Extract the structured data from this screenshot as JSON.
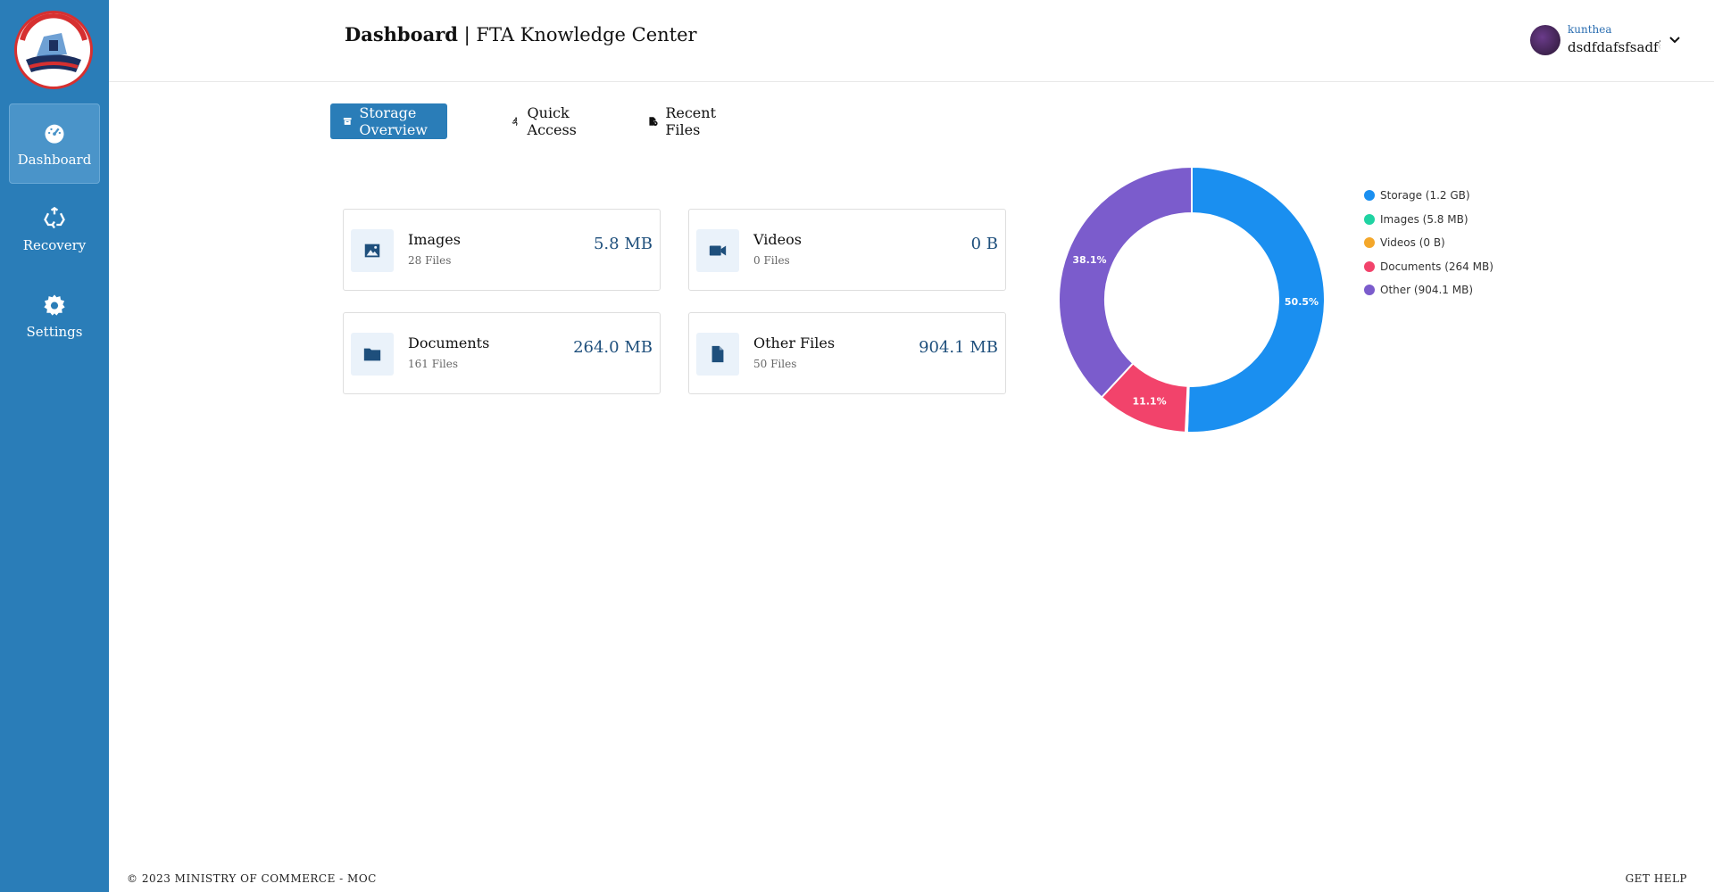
{
  "sidebar": {
    "items": [
      {
        "label": "Dashboard",
        "icon": "speedometer-icon",
        "active": true
      },
      {
        "label": "Recovery",
        "icon": "recycle-icon",
        "active": false
      },
      {
        "label": "Settings",
        "icon": "gear-icon",
        "active": false
      }
    ]
  },
  "header": {
    "title_bold": "Dashboard",
    "title_rest": " | FTA Knowledge Center",
    "user_name": "kunthea",
    "user_sub": "dsdfdafsfsadf៏"
  },
  "tabs": [
    {
      "label": "Storage Overview",
      "icon": "archive-icon",
      "active": true
    },
    {
      "label": "Quick Access",
      "icon": "running-icon",
      "active": false
    },
    {
      "label": "Recent Files",
      "icon": "file-clock-icon",
      "active": false
    }
  ],
  "cards": [
    {
      "title": "Images",
      "files": "28 Files",
      "size": "5.8 MB",
      "icon": "image-icon"
    },
    {
      "title": "Videos",
      "files": "0 Files",
      "size": "0 B",
      "icon": "video-icon"
    },
    {
      "title": "Documents",
      "files": "161 Files",
      "size": "264.0 MB",
      "icon": "folder-icon"
    },
    {
      "title": "Other Files",
      "files": "50 Files",
      "size": "904.1 MB",
      "icon": "file-icon"
    }
  ],
  "chart_data": {
    "type": "pie",
    "categories": [
      "Storage (1.2 GB)",
      "Images (5.8 MB)",
      "Videos (0 B)",
      "Documents (264 MB)",
      "Other (904.1 MB)"
    ],
    "values": [
      50.5,
      0.2,
      0,
      11.1,
      38.1
    ],
    "labels": [
      "50.5%",
      "",
      "",
      "11.1%",
      "38.1%"
    ],
    "colors": [
      "#1a8ff0",
      "#1fd3a2",
      "#f4a72a",
      "#f2436b",
      "#7b5ccc"
    ],
    "legend_position": "right"
  },
  "footer": {
    "copyright": "© 2023 MINISTRY OF COMMERCE - MOC",
    "help": "GET HELP"
  }
}
